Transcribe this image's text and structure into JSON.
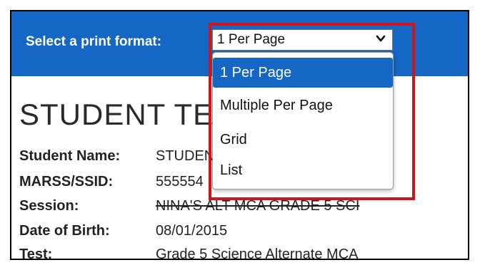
{
  "header": {
    "print_format_label": "Select a print format:",
    "background_color": "#1467c4"
  },
  "select": {
    "value": "1 Per Page",
    "icon": "chevron-down-icon",
    "options": [
      "1 Per Page",
      "Multiple Per Page",
      "Grid",
      "List"
    ]
  },
  "ticket": {
    "title": "STUDENT TEST TICKET",
    "fields": [
      {
        "label": "Student Name:",
        "value": "STUDENT"
      },
      {
        "label": "MARSS/SSID:",
        "value": "555554"
      },
      {
        "label": "Session:",
        "value": "NINA'S ALT MCA GRADE 5 SCI"
      },
      {
        "label": "Date of Birth:",
        "value": "08/01/2015"
      },
      {
        "label": "Test:",
        "value": "Grade 5 Science Alternate MCA"
      }
    ]
  },
  "annotation": {
    "highlight_color": "#d0141a"
  }
}
